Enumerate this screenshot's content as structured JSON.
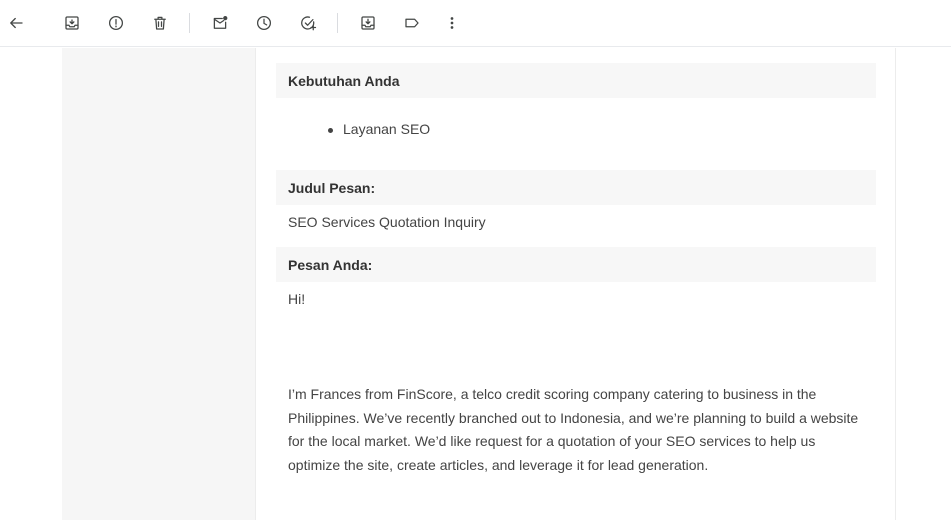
{
  "toolbar": {
    "buttons": [
      {
        "name": "back",
        "icon": "arrow-left-icon"
      },
      {
        "name": "archive",
        "icon": "archive-icon"
      },
      {
        "name": "report-spam",
        "icon": "report-icon"
      },
      {
        "name": "delete",
        "icon": "trash-icon"
      },
      {
        "name": "mark-unread",
        "icon": "mail-unread-icon"
      },
      {
        "name": "snooze",
        "icon": "clock-icon"
      },
      {
        "name": "add-task",
        "icon": "add-task-icon"
      },
      {
        "name": "move-to",
        "icon": "move-to-icon"
      },
      {
        "name": "label",
        "icon": "label-icon"
      },
      {
        "name": "more",
        "icon": "more-vertical-icon"
      }
    ]
  },
  "message": {
    "needs_heading": "Kebutuhan Anda",
    "needs_items": [
      "Layanan SEO"
    ],
    "subject_heading": "Judul Pesan:",
    "subject_value": "SEO Services Quotation Inquiry",
    "body_heading": "Pesan Anda:",
    "greeting": "Hi!",
    "paragraph": "I’m Frances from FinScore, a telco credit scoring company catering to business in the Philippines. We’ve recently branched out to Indonesia, and we’re planning to build a website for the local market. We’d like request for a quotation of your SEO services to help us optimize the site, create articles, and leverage it for lead generation."
  },
  "colors": {
    "icon": "#444746",
    "text": "#444444",
    "heading_bg": "#f7f7f7",
    "outer_bg": "#f6f6f6"
  }
}
